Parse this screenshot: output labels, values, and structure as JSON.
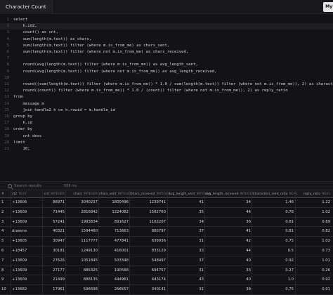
{
  "window": {
    "tab_title": "Character Count",
    "run_button_label": "My"
  },
  "editor": {
    "lines": [
      {
        "n": "1",
        "text": "select"
      },
      {
        "n": "2",
        "text": "    h.id2,"
      },
      {
        "n": "3",
        "text": "    count() as cnt,"
      },
      {
        "n": "4",
        "text": "    sum(length(m.text)) as chars,"
      },
      {
        "n": "5",
        "text": "    sum(length(m.text)) filter (where m.is_from_me) as chars_sent,"
      },
      {
        "n": "6",
        "text": "    sum(length(m.text)) filter (where not m.is_from_me) as chars_received,"
      },
      {
        "n": "7",
        "text": ""
      },
      {
        "n": "8",
        "text": "    round(avg(length(m.text)) filter (where m.is_from_me)) as avg_length_sent,"
      },
      {
        "n": "9",
        "text": "    round(avg(length(m.text)) filter (where not m.is_from_me)) as avg_length_received,"
      },
      {
        "n": "10",
        "text": ""
      },
      {
        "n": "11",
        "text": "    round((sum(length(m.text)) filter (where m.is_from_me)) * 1.0 / sum(length(m.text)) filter (where not m.is_from_me)), 2) as characters_sent_ratio,"
      },
      {
        "n": "12",
        "text": "    round((count() filter (where m.is_from_me)) * 1.0 / (count() filter (where not m.is_from_me)), 2) as reply_ratio"
      },
      {
        "n": "13",
        "text": "from"
      },
      {
        "n": "14",
        "text": "    message m"
      },
      {
        "n": "15",
        "text": "    join handle2 h on h.rowid = m.handle_id"
      },
      {
        "n": "16",
        "text": "group by"
      },
      {
        "n": "17",
        "text": "    h.id"
      },
      {
        "n": "18",
        "text": "order by"
      },
      {
        "n": "19",
        "text": "    cnt desc"
      },
      {
        "n": "20",
        "text": "limit"
      },
      {
        "n": "21",
        "text": "    10;"
      }
    ]
  },
  "search": {
    "placeholder": "Search results",
    "timing": "508 ms"
  },
  "table": {
    "columns": [
      {
        "label": "id2",
        "type": "TEXT"
      },
      {
        "label": "cnt",
        "type": "INTEGER"
      },
      {
        "label": "chars",
        "type": "INTEGER"
      },
      {
        "label": "chars_sent",
        "type": "INTEGER"
      },
      {
        "label": "chars_received",
        "type": "INTEGER"
      },
      {
        "label": "avg_length_sent",
        "type": "INTEGER"
      },
      {
        "label": "avg_length_received",
        "type": "INTEGER"
      },
      {
        "label": "characters_sent_ratio",
        "type": "REAL"
      },
      {
        "label": "reply_ratio",
        "type": "REAL"
      }
    ],
    "rows": [
      [
        "1",
        "+13606",
        "88971",
        "3040237",
        "1800496",
        "1239741",
        "41",
        "34",
        "1.46",
        "1.22"
      ],
      [
        "2",
        "+13609",
        "71445",
        "2816842",
        "1224082",
        "1582760",
        "35",
        "44",
        "0.78",
        "1.02"
      ],
      [
        "3",
        "+13609",
        "57241",
        "1993834",
        "891627",
        "1102207",
        "34",
        "36",
        "0.81",
        "0.89"
      ],
      [
        "4",
        "drawme",
        "40321",
        "1594460",
        "713663",
        "880797",
        "37",
        "41",
        "0.81",
        "0.82"
      ],
      [
        "5",
        "+13605",
        "30947",
        "1117777",
        "477841",
        "639936",
        "31",
        "42",
        "0.75",
        "1.02"
      ],
      [
        "6",
        "+18457",
        "30181",
        "1249130",
        "416001",
        "833129",
        "33",
        "44",
        "0.5",
        "0.73"
      ],
      [
        "7",
        "+13609",
        "27626",
        "1051845",
        "503348",
        "548497",
        "37",
        "40",
        "0.92",
        "1.01"
      ],
      [
        "8",
        "+13609",
        "27177",
        "885325",
        "190568",
        "694757",
        "31",
        "33",
        "0.27",
        "0.26"
      ],
      [
        "9",
        "+13609",
        "21499",
        "888135",
        "444961",
        "443174",
        "43",
        "40",
        "1.0",
        "0.92"
      ],
      [
        "10",
        "+13682",
        "17961",
        "596698",
        "256557",
        "340141",
        "31",
        "38",
        "0.75",
        "0.91"
      ]
    ]
  }
}
